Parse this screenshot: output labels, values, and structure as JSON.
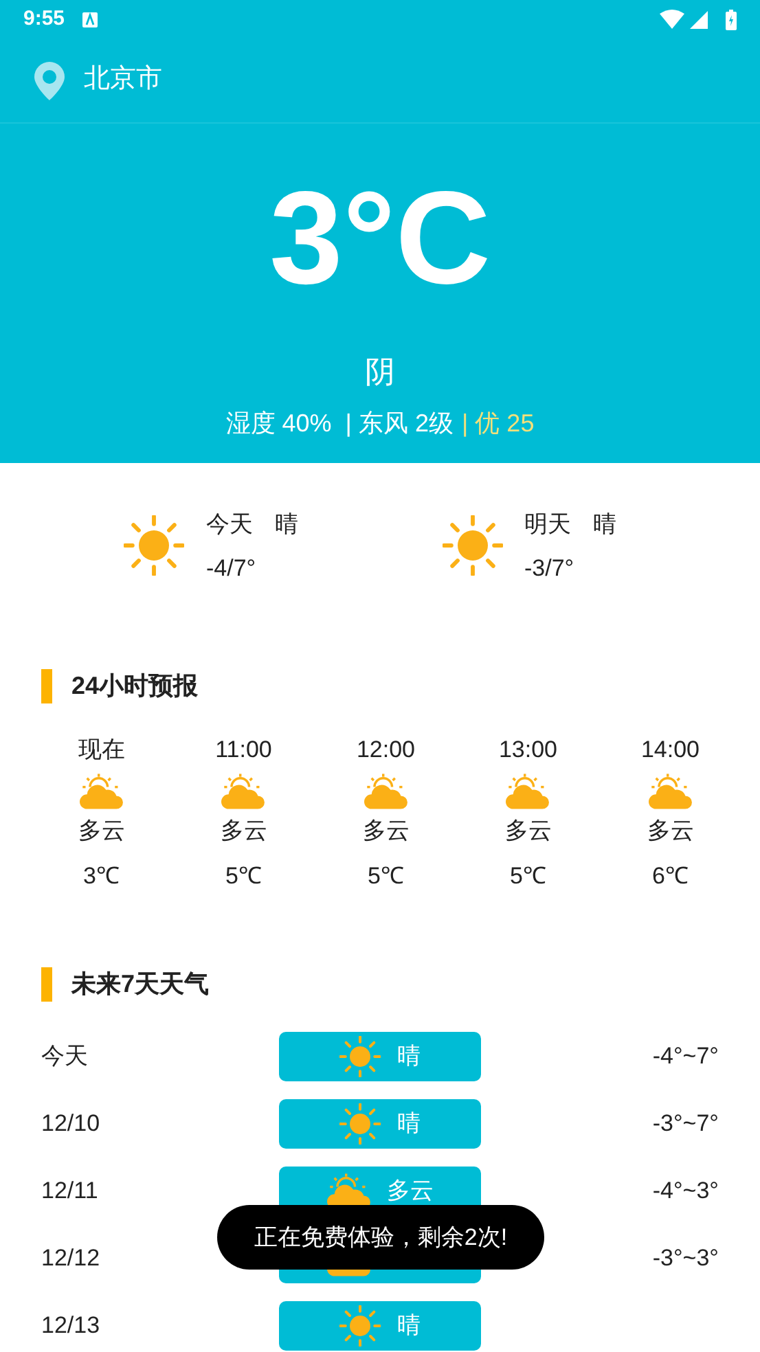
{
  "status_bar": {
    "time": "9:55"
  },
  "location": {
    "city": "北京市"
  },
  "current": {
    "temperature": "3°C",
    "condition": "阴",
    "details": "湿度 40%  | 东风 2级",
    "aqi": "| 优 25"
  },
  "summary": [
    {
      "day": "今天",
      "condition": "晴",
      "range": "-4/7°",
      "kind": "sunny"
    },
    {
      "day": "明天",
      "condition": "晴",
      "range": "-3/7°",
      "kind": "sunny"
    }
  ],
  "hourly": {
    "title": "24小时预报",
    "items": [
      {
        "time": "现在",
        "kind": "cloudy",
        "condition": "多云",
        "temp": "3℃"
      },
      {
        "time": "11:00",
        "kind": "cloudy",
        "condition": "多云",
        "temp": "5℃"
      },
      {
        "time": "12:00",
        "kind": "cloudy",
        "condition": "多云",
        "temp": "5℃"
      },
      {
        "time": "13:00",
        "kind": "cloudy",
        "condition": "多云",
        "temp": "5℃"
      },
      {
        "time": "14:00",
        "kind": "cloudy",
        "condition": "多云",
        "temp": "6℃"
      }
    ]
  },
  "daily": {
    "title": "未来7天天气",
    "rows": [
      {
        "date": "今天",
        "kind": "sunny",
        "condition": "晴",
        "range": "-4°~7°"
      },
      {
        "date": "12/10",
        "kind": "sunny",
        "condition": "晴",
        "range": "-3°~7°"
      },
      {
        "date": "12/11",
        "kind": "cloudy",
        "condition": "多云",
        "range": "-4°~3°"
      },
      {
        "date": "12/12",
        "kind": "cloudy",
        "range": "-3°~3°"
      },
      {
        "date": "12/13",
        "kind": "sunny",
        "condition": "晴"
      }
    ]
  },
  "toast": "正在免费体验，剩余2次!"
}
